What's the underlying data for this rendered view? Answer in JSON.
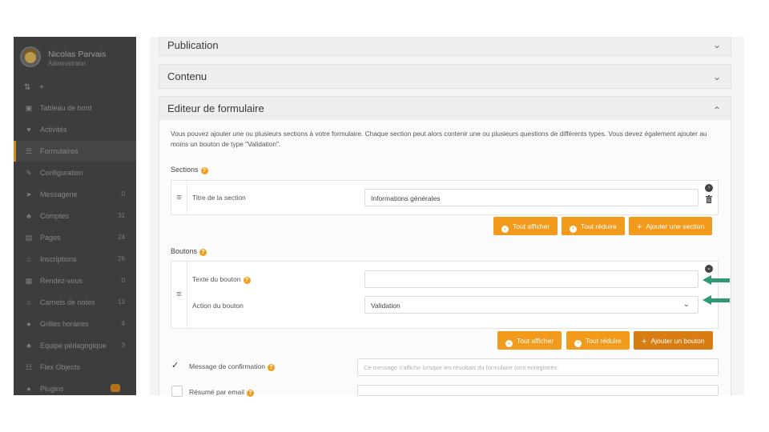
{
  "user": {
    "name": "Nicolas Parvais",
    "role": "Administrator"
  },
  "sidebar": {
    "tools": [
      "⇅",
      "+"
    ],
    "items": [
      {
        "label": "Tableau de bord",
        "icon": "gauge-icon",
        "glyph": "▣",
        "count": ""
      },
      {
        "label": "Activités",
        "icon": "heart-icon",
        "glyph": "♥",
        "count": ""
      },
      {
        "label": "Formulaires",
        "icon": "form-icon",
        "glyph": "☰",
        "count": "",
        "active": true
      },
      {
        "label": "Configuration",
        "icon": "wrench-icon",
        "glyph": "✎",
        "count": ""
      },
      {
        "label": "Messagerie",
        "icon": "send-icon",
        "glyph": "➤",
        "count": "0"
      },
      {
        "label": "Comptes",
        "icon": "users-icon",
        "glyph": "♣",
        "count": "31"
      },
      {
        "label": "Pages",
        "icon": "file-icon",
        "glyph": "▤",
        "count": "24"
      },
      {
        "label": "Inscriptions",
        "icon": "institution-icon",
        "glyph": "⌂",
        "count": "26"
      },
      {
        "label": "Rendez-vous",
        "icon": "calendar-icon",
        "glyph": "▦",
        "count": "0"
      },
      {
        "label": "Carnets de notes",
        "icon": "notebook-icon",
        "glyph": "⌂",
        "count": "13"
      },
      {
        "label": "Grilles horaires",
        "icon": "clock-icon",
        "glyph": "●",
        "count": "4"
      },
      {
        "label": "Equipe pédagogique",
        "icon": "team-icon",
        "glyph": "♣",
        "count": "3"
      },
      {
        "label": "Flex Objects",
        "icon": "list-icon",
        "glyph": "☷",
        "count": ""
      },
      {
        "label": "Plugins",
        "icon": "plug-icon",
        "glyph": "●",
        "count": ""
      }
    ]
  },
  "accordion": {
    "publication": "Publication",
    "contenu": "Contenu",
    "editeur": "Editeur de formulaire"
  },
  "editor": {
    "description": "Vous pouvez ajouter une ou plusieurs sections à votre formulaire. Chaque section peut alors contenir une ou plusieurs questions de différents types. Vous devez également ajouter au moins un bouton de type \"Validation\".",
    "sections_label": "Sections",
    "section_title_label": "Titre de la section",
    "section_title_value": "Informations générales",
    "show_all": "Tout afficher",
    "collapse_all": "Tout réduire",
    "add_section": "Ajouter une section",
    "buttons_label": "Boutons",
    "button_text_label": "Texte du bouton",
    "button_action_label": "Action du bouton",
    "button_action_value": "Validation",
    "add_button": "Ajouter un bouton",
    "confirm_label": "Message de confirmation",
    "confirm_placeholder": "Ce message s'affiche lorsque les résultats du formulaire sont enregistrés.",
    "email_label": "Résumé par email"
  },
  "colors": {
    "accent": "#f19a1b",
    "accent_dark": "#d77d14",
    "sidebar": "#3d3d3d",
    "arrow": "#2f9a72"
  }
}
